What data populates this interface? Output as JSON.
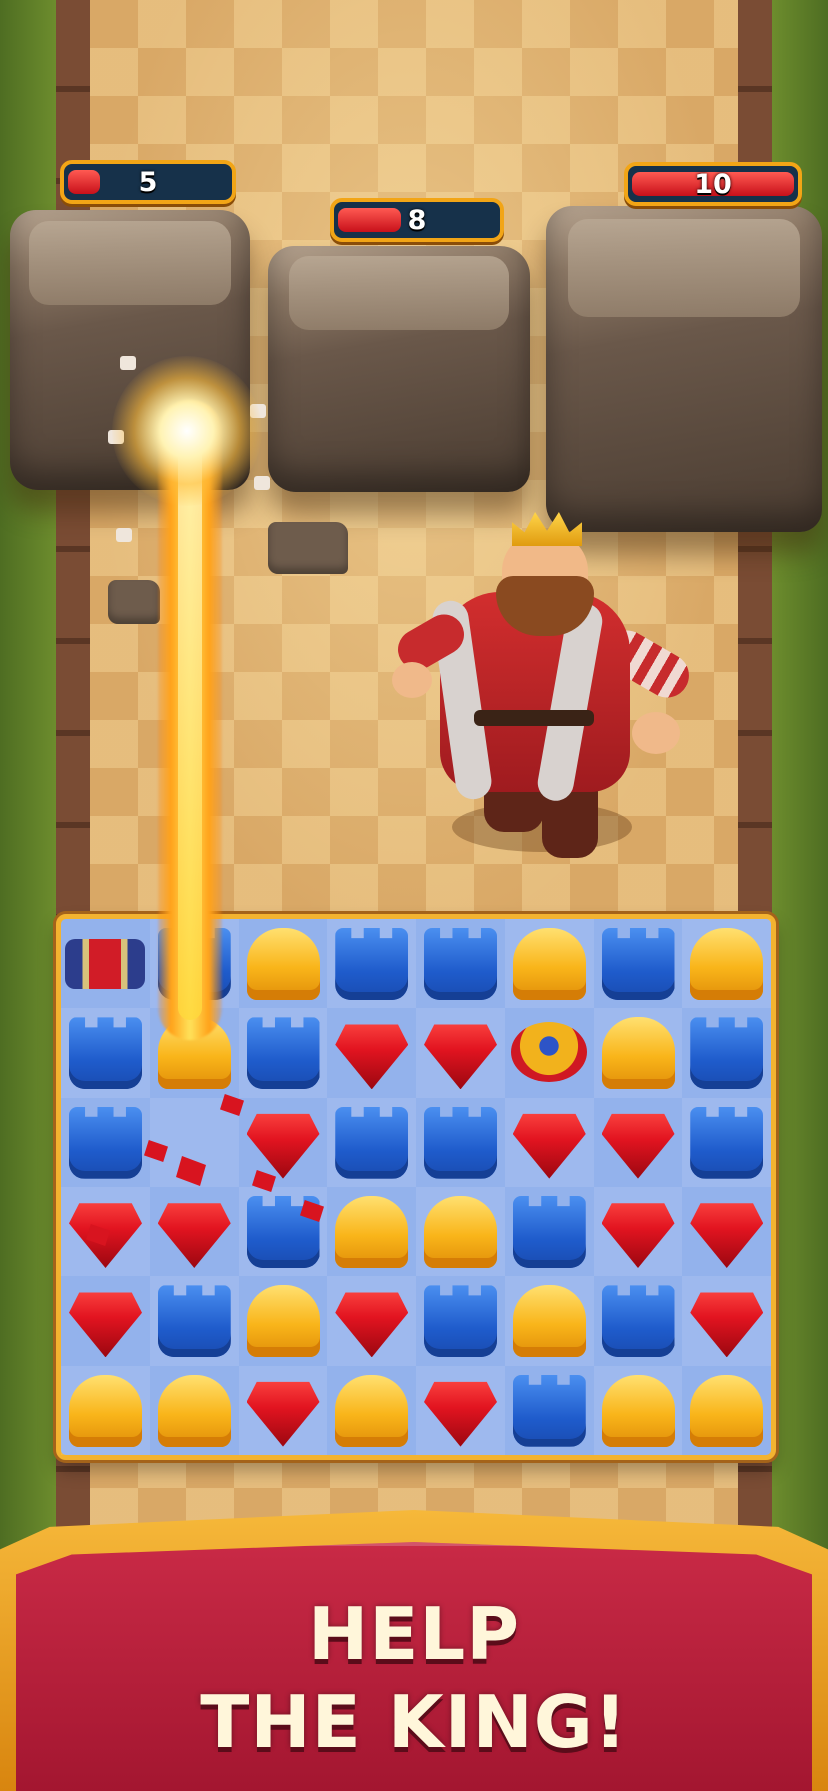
{
  "targets": [
    {
      "name": "rock-left",
      "hp": "5",
      "hp_fraction": 0.2
    },
    {
      "name": "rock-middle",
      "hp": "8",
      "hp_fraction": 0.4
    },
    {
      "name": "rock-right",
      "hp": "10",
      "hp_fraction": 1.0
    }
  ],
  "board": {
    "columns": 8,
    "rows": 6,
    "pieces": [
      [
        "rocket",
        "tower",
        "helmet",
        "tower",
        "tower",
        "helmet",
        "tower",
        "helmet"
      ],
      [
        "tower",
        "helmet",
        "tower",
        "gem",
        "gem",
        "topper",
        "helmet",
        "tower"
      ],
      [
        "tower",
        "empty",
        "gem",
        "tower",
        "tower",
        "gem",
        "gem",
        "tower"
      ],
      [
        "gem",
        "gem",
        "tower",
        "helmet",
        "helmet",
        "tower",
        "gem",
        "gem"
      ],
      [
        "gem",
        "tower",
        "helmet",
        "gem",
        "tower",
        "helmet",
        "tower",
        "gem"
      ],
      [
        "helmet",
        "helmet",
        "gem",
        "helmet",
        "gem",
        "tower",
        "helmet",
        "helmet"
      ]
    ]
  },
  "character": "king",
  "effect": "fire-beam",
  "banner": {
    "line1": "HELP",
    "line2": "THE KING!"
  },
  "colors": {
    "tower": "#2a6fe0",
    "helmet": "#f9b51a",
    "gem": "#e21420",
    "board_frame": "#f3b330",
    "banner": "#b81f3a"
  }
}
